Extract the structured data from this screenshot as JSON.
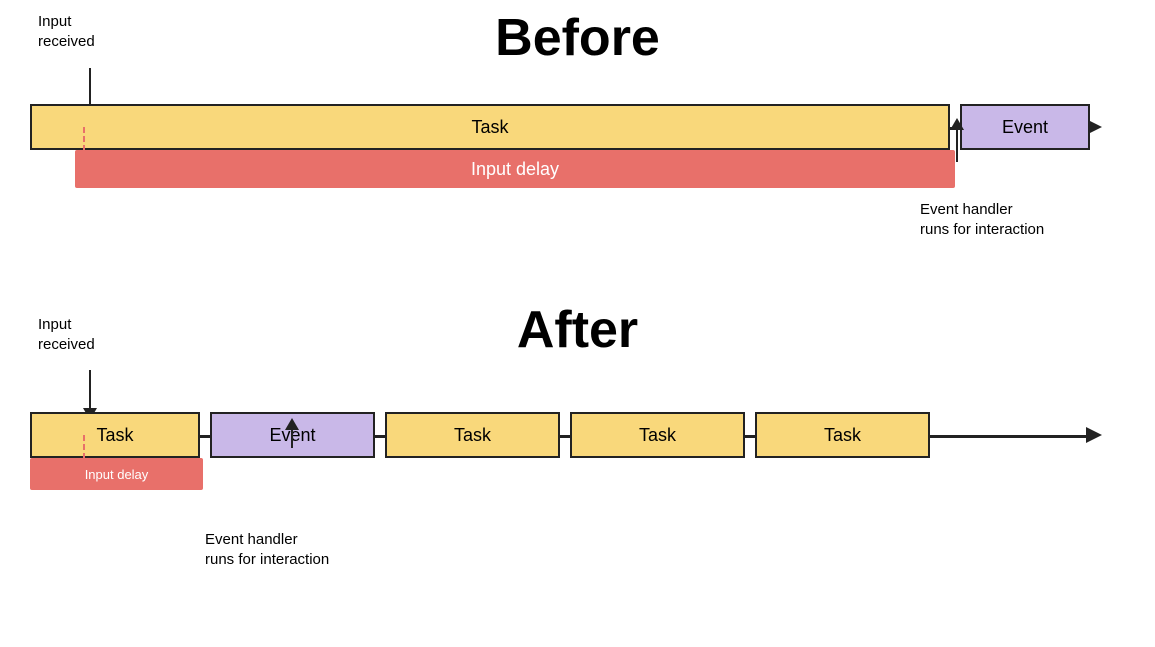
{
  "before": {
    "title": "Before",
    "input_received_label": "Input\nreceived",
    "task_label": "Task",
    "event_label": "Event",
    "input_delay_label": "Input delay",
    "event_handler_label": "Event handler\nruns for interaction"
  },
  "after": {
    "title": "After",
    "input_received_label": "Input\nreceived",
    "task_label": "Task",
    "task2_label": "Task",
    "task3_label": "Task",
    "task4_label": "Task",
    "event_label": "Event",
    "input_delay_label": "Input delay",
    "event_handler_label": "Event handler\nruns for interaction"
  },
  "colors": {
    "task": "#f9d87b",
    "event": "#c9b8e8",
    "input_delay": "#e8706a",
    "line": "#222222",
    "white": "#ffffff"
  }
}
